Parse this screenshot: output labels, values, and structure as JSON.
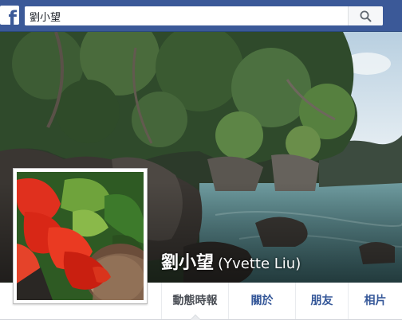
{
  "topbar": {
    "logo_icon": "facebook-f-icon",
    "search_value": "劉小望",
    "search_icon": "search-icon"
  },
  "profile": {
    "name": "劉小望",
    "alternate_name": "(Yvette Liu)"
  },
  "tabs": [
    {
      "label": "動態時報",
      "active": true
    },
    {
      "label": "關於",
      "active": false
    },
    {
      "label": "朋友",
      "active": false
    },
    {
      "label": "相片",
      "active": false
    }
  ],
  "colors": {
    "brand_blue": "#3b5998",
    "link_blue": "#365899",
    "page_bg": "#e9ebee"
  }
}
